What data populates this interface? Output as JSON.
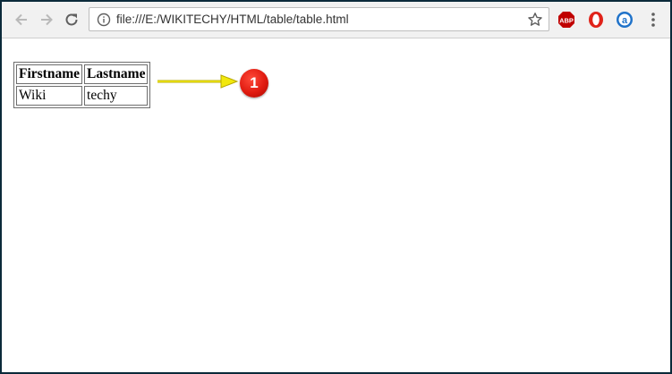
{
  "browser": {
    "url": "file:///E:/WIKITECHY/HTML/table/table.html",
    "extensions": [
      {
        "name": "adblock-plus",
        "label": "ABP",
        "color": "#c00000"
      },
      {
        "name": "opera-addon",
        "label": "",
        "color": "#e0231a"
      },
      {
        "name": "amazon-assistant",
        "label": "a",
        "color": "#1f72c9"
      }
    ]
  },
  "table": {
    "headers": [
      "Firstname",
      "Lastname"
    ],
    "rows": [
      [
        "Wiki",
        "techy"
      ]
    ]
  },
  "annotation": {
    "badge_number": "1",
    "arrow_color": "#f2e80c",
    "badge_color": "#e01b10"
  },
  "colors": {
    "frame": "#0b2a3a",
    "toolbar": "#f1f1f1"
  }
}
